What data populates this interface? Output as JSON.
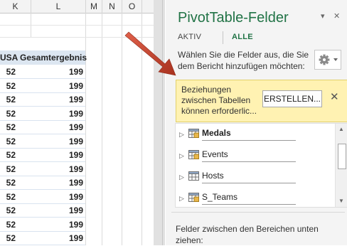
{
  "sheet": {
    "columns": [
      {
        "letter": "K"
      },
      {
        "letter": "L"
      },
      {
        "letter": "M"
      },
      {
        "letter": "N"
      },
      {
        "letter": "O"
      }
    ],
    "headers": {
      "usa": "USA",
      "total": "Gesamtergebnis"
    },
    "rows": [
      {
        "usa": "52",
        "total": "199"
      },
      {
        "usa": "52",
        "total": "199"
      },
      {
        "usa": "52",
        "total": "199"
      },
      {
        "usa": "52",
        "total": "199"
      },
      {
        "usa": "52",
        "total": "199"
      },
      {
        "usa": "52",
        "total": "199"
      },
      {
        "usa": "52",
        "total": "199"
      },
      {
        "usa": "52",
        "total": "199"
      },
      {
        "usa": "52",
        "total": "199"
      },
      {
        "usa": "52",
        "total": "199"
      },
      {
        "usa": "52",
        "total": "199"
      },
      {
        "usa": "52",
        "total": "199"
      },
      {
        "usa": "52",
        "total": "199"
      }
    ]
  },
  "pane": {
    "title": "PivotTable-Felder",
    "dropdown_glyph": "▾",
    "close_glyph": "✕",
    "tabs": {
      "active": "AKTIV",
      "all": "ALLE"
    },
    "instruction": "Wählen Sie die Felder aus, die Sie dem Bericht hinzufügen möchten:",
    "gear_icon": "gear-icon",
    "notice": {
      "text": "Beziehungen zwischen Tabellen können erforderlic...",
      "button": "ERSTELLEN...",
      "close": "✕"
    },
    "fields": [
      {
        "label": "Medals",
        "bold": true,
        "icon": "table-linked-icon"
      },
      {
        "label": "Events",
        "bold": false,
        "icon": "table-linked-icon"
      },
      {
        "label": "Hosts",
        "bold": false,
        "icon": "table-icon"
      },
      {
        "label": "S_Teams",
        "bold": false,
        "icon": "table-linked-icon"
      }
    ],
    "areas_text": "Felder zwischen den Bereichen unten ziehen:"
  },
  "colors": {
    "accent": "#217346",
    "notice_bg": "#fff2b2",
    "pivot_header": "#dce6f1",
    "arrow": "#c0392b"
  }
}
